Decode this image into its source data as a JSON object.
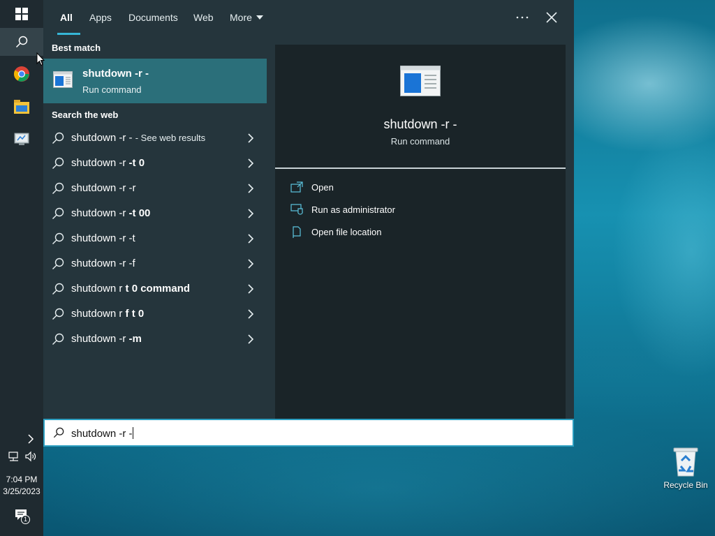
{
  "search_tabs": [
    {
      "label": "All",
      "active": true
    },
    {
      "label": "Apps",
      "active": false
    },
    {
      "label": "Documents",
      "active": false
    },
    {
      "label": "Web",
      "active": false
    },
    {
      "label": "More",
      "active": false
    }
  ],
  "header_actions": {
    "more_options_icon": "ellipsis-icon",
    "close_icon": "close-icon"
  },
  "best_match": {
    "section_title": "Best match",
    "title": "shutdown -r -",
    "subtitle": "Run command"
  },
  "web_search": {
    "section_title": "Search the web",
    "results": [
      {
        "prefix": "shutdown -r - ",
        "bold": "",
        "suffix": "- See web results"
      },
      {
        "prefix": "shutdown -r ",
        "bold": "-t 0",
        "suffix": ""
      },
      {
        "prefix": "shutdown -r -r",
        "bold": "",
        "suffix": ""
      },
      {
        "prefix": "shutdown -r ",
        "bold": "-t 00",
        "suffix": ""
      },
      {
        "prefix": "shutdown -r -t",
        "bold": "",
        "suffix": ""
      },
      {
        "prefix": "shutdown -r -f",
        "bold": "",
        "suffix": ""
      },
      {
        "prefix": "shutdown r ",
        "bold": "t 0 command",
        "suffix": ""
      },
      {
        "prefix": "shutdown r ",
        "bold": "f t 0",
        "suffix": ""
      },
      {
        "prefix": "shutdown -r ",
        "bold": "-m",
        "suffix": ""
      }
    ]
  },
  "detail": {
    "title": "shutdown -r -",
    "subtitle": "Run command",
    "actions": [
      {
        "label": "Open",
        "icon": "open-icon"
      },
      {
        "label": "Run as administrator",
        "icon": "admin-shield-icon"
      },
      {
        "label": "Open file location",
        "icon": "file-location-icon"
      }
    ]
  },
  "search_box": {
    "value": "shutdown -r -"
  },
  "taskbar": {
    "time": "7:04 PM",
    "date": "3/25/2023",
    "notification_count": "1"
  },
  "desktop": {
    "recycle_bin_label": "Recycle Bin"
  },
  "colors": {
    "accent": "#36b6d6",
    "best_match_bg": "#2b6f7a",
    "panel_bg": "#25353c",
    "detail_bg": "#1a2428",
    "taskbar_bg": "#1f2a30"
  }
}
